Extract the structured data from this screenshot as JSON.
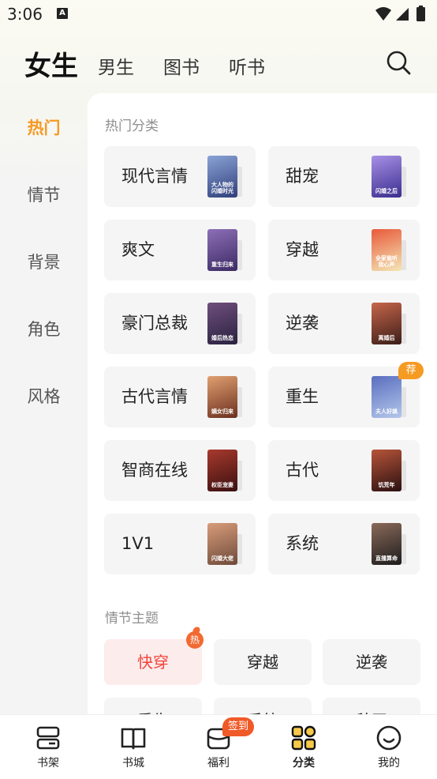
{
  "status_bar": {
    "time": "3:06",
    "notif_icon": "A"
  },
  "header": {
    "tabs": [
      {
        "label": "女生",
        "active": true
      },
      {
        "label": "男生",
        "active": false
      },
      {
        "label": "图书",
        "active": false
      },
      {
        "label": "听书",
        "active": false
      }
    ],
    "search_icon": "search-icon"
  },
  "sidebar": {
    "items": [
      {
        "label": "热门",
        "active": true
      },
      {
        "label": "情节",
        "active": false
      },
      {
        "label": "背景",
        "active": false
      },
      {
        "label": "角色",
        "active": false
      },
      {
        "label": "风格",
        "active": false
      }
    ]
  },
  "hot_section": {
    "title": "热门分类",
    "categories": [
      {
        "label": "现代言情",
        "cover_text": "大人物的闪婚时光",
        "colors": [
          "#2f3f7a",
          "#8aa3d6"
        ]
      },
      {
        "label": "甜宠",
        "cover_text": "闪婚之后",
        "colors": [
          "#3a2e8e",
          "#a890e6"
        ]
      },
      {
        "label": "爽文",
        "cover_text": "重生归来",
        "colors": [
          "#3c2a63",
          "#8d6fb8"
        ]
      },
      {
        "label": "穿越",
        "cover_text": "全家偷听我心声",
        "colors": [
          "#f4e6b5",
          "#e85a3a"
        ]
      },
      {
        "label": "豪门总裁",
        "cover_text": "婚后热恋",
        "colors": [
          "#2a2140",
          "#6e4f7c"
        ]
      },
      {
        "label": "逆袭",
        "cover_text": "离婚后",
        "colors": [
          "#3b1d18",
          "#c7664a"
        ]
      },
      {
        "label": "古代言情",
        "cover_text": "嫡女归来",
        "colors": [
          "#6b2f1f",
          "#e0a070"
        ]
      },
      {
        "label": "重生",
        "cover_text": "夫人好飒",
        "colors": [
          "#b3c7ea",
          "#5a6ec0"
        ],
        "badge": "荐"
      },
      {
        "label": "智商在线",
        "cover_text": "权臣宠妻",
        "colors": [
          "#3a0f0f",
          "#a83a2e"
        ]
      },
      {
        "label": "古代",
        "cover_text": "饥荒年",
        "colors": [
          "#2a1010",
          "#b8553a"
        ]
      },
      {
        "label": "1V1",
        "cover_text": "闪婚大佬",
        "colors": [
          "#6e4a3a",
          "#d89c7a"
        ]
      },
      {
        "label": "系统",
        "cover_text": "直播算命",
        "colors": [
          "#1c1c1c",
          "#8a6a5a"
        ]
      }
    ]
  },
  "plot_section": {
    "title": "情节主题",
    "tags": [
      {
        "label": "快穿",
        "active": true,
        "badge": "热"
      },
      {
        "label": "穿越",
        "active": false
      },
      {
        "label": "逆袭",
        "active": false
      },
      {
        "label": "重生",
        "active": false
      },
      {
        "label": "系统",
        "active": false
      },
      {
        "label": "种田",
        "active": false
      }
    ]
  },
  "bottom_nav": {
    "items": [
      {
        "label": "书架",
        "icon": "bookshelf-icon",
        "active": false
      },
      {
        "label": "书城",
        "icon": "book-open-icon",
        "active": false
      },
      {
        "label": "福利",
        "icon": "gift-icon",
        "active": false,
        "badge": "签到"
      },
      {
        "label": "分类",
        "icon": "category-grid-icon",
        "active": true
      },
      {
        "label": "我的",
        "icon": "profile-smile-icon",
        "active": false
      }
    ]
  },
  "colors": {
    "accent": "#f59a23",
    "active_tag": "#f0443a",
    "badge_red": "#f05a28"
  }
}
